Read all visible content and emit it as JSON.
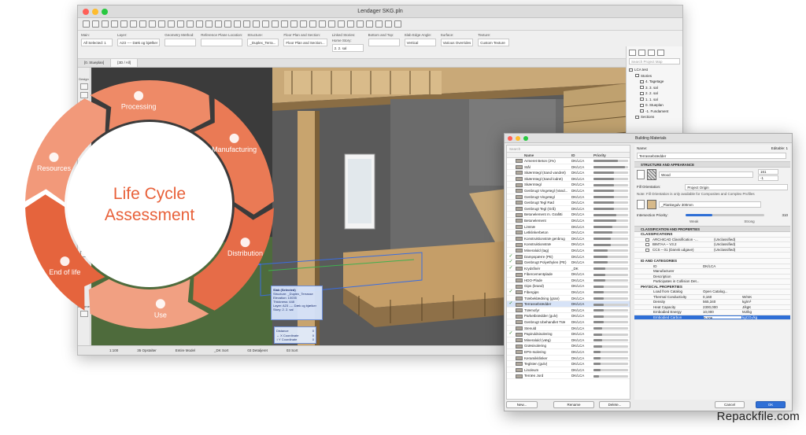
{
  "window": {
    "title": "Lendager SKG.pln"
  },
  "infobox": [
    {
      "label": "Main:",
      "value": "All Selected: 1"
    },
    {
      "label": "Layer:",
      "value": "A23 ---- Dæk og bjælker"
    },
    {
      "label": "Geometry Method:",
      "value": ""
    },
    {
      "label": "Reference Plane Location:",
      "value": ""
    },
    {
      "label": "Structure:",
      "value": "_Duplex_Terra..."
    },
    {
      "label": "Floor Plan and Section:",
      "value": "Floor Plan and Section..."
    },
    {
      "label": "Linked Stories:",
      "value": "2. 2. sal"
    },
    {
      "label": "Bottom and Top:",
      "value": ""
    },
    {
      "label": "Slab Edge Angle:",
      "value": "Vertical"
    },
    {
      "label": "Surface:",
      "value": "Various Overrides"
    },
    {
      "label": "Texture:",
      "value": "Custom Texture"
    }
  ],
  "infobox_extra": {
    "home_story_label": "Home Story:"
  },
  "tabs": [
    "[0. Stueplan]",
    "[3D / All]"
  ],
  "leftpanel": {
    "design_label": "Design",
    "viewpoint_label": "Viewpoi",
    "document_label": "Docume"
  },
  "statusbar": [
    "1:100",
    "35 Opstalter",
    "Entire Model",
    "_DK Sort",
    "03 Detaljeret",
    "03 Sort"
  ],
  "navigator": {
    "root": "LCA test",
    "items": [
      {
        "level": 1,
        "label": "Stories"
      },
      {
        "level": 2,
        "label": "4. Tagetage"
      },
      {
        "level": 2,
        "label": "3. 3. sal"
      },
      {
        "level": 2,
        "label": "2. 2. sal"
      },
      {
        "level": 2,
        "label": "1. 1. sal"
      },
      {
        "level": 2,
        "label": "0. Stueplan"
      },
      {
        "level": 2,
        "label": "-1. Fundament"
      },
      {
        "level": 1,
        "label": "Sections"
      }
    ]
  },
  "selection_popup": {
    "lines": [
      "Slab (Selected)",
      "Structure: _Duplex_Terrasse",
      "Elevation: 10035",
      "Thickness: 448",
      "Layer: A23 ---- Dæk og bjælker",
      "Story: 2. 2. sal"
    ]
  },
  "coord_popup": {
    "lines": [
      "Distance",
      "↔ X Coordinate",
      "↕ Y Coordinate"
    ],
    "values": [
      "0",
      "0",
      "0"
    ]
  },
  "lca_graphic": {
    "title_line1": "Life Cycle",
    "title_line2": "Assessment",
    "stages": [
      "Resources",
      "Processing",
      "Manufacturing",
      "Distribution",
      "Use",
      "End of life"
    ]
  },
  "building_materials": {
    "title": "Building Materials",
    "search_placeholder": "Search",
    "columns": {
      "name": "Name",
      "id": "ID",
      "priority": "Priority"
    },
    "materials": [
      {
        "name": "Armeret Beton (2%)",
        "id": "DK/LCA",
        "priority": 0.7,
        "checked": false
      },
      {
        "name": "Stål",
        "id": "DK/LCA",
        "priority": 0.9,
        "checked": false
      },
      {
        "name": "Skærmtegl (Sand vandret)",
        "id": "DK/LCA",
        "priority": 0.6,
        "checked": false
      },
      {
        "name": "Skærmtegl (Sand lodret)",
        "id": "DK/LCA",
        "priority": 0.6,
        "checked": false
      },
      {
        "name": "Skærmtegl",
        "id": "DK/LCA",
        "priority": 0.6,
        "checked": false
      },
      {
        "name": "Genbrugt Vingetegl (Vand...",
        "id": "DK/LCA",
        "priority": 0.6,
        "checked": false
      },
      {
        "name": "Genbrugt Vingetegl",
        "id": "DK/LCA",
        "priority": 0.6,
        "checked": false
      },
      {
        "name": "Genbrugt Tegl Rød",
        "id": "DK/LCA",
        "priority": 0.6,
        "checked": false
      },
      {
        "name": "Genbrugt Tegl (Grå)",
        "id": "DK/LCA",
        "priority": 0.6,
        "checked": false
      },
      {
        "name": "Betonelement m. Grafitti",
        "id": "DK/LCA",
        "priority": 0.65,
        "checked": false
      },
      {
        "name": "Betonelement",
        "id": "DK/LCA",
        "priority": 0.65,
        "checked": false
      },
      {
        "name": "Limtræ",
        "id": "DK/LCA",
        "priority": 0.55,
        "checked": false
      },
      {
        "name": "Letklinkerbeton",
        "id": "DK/LCA",
        "priority": 0.55,
        "checked": false
      },
      {
        "name": "Konstruktionstræ genbrug",
        "id": "DK/LCA",
        "priority": 0.5,
        "checked": false
      },
      {
        "name": "Konstruktionstræ",
        "id": "DK/LCA",
        "priority": 0.5,
        "checked": false
      },
      {
        "name": "Mineraluld (tag)",
        "id": "DK/LCA",
        "priority": 0.4,
        "checked": false
      },
      {
        "name": "Dampspærre (PE)",
        "id": "DK/LCA",
        "priority": 0.4,
        "checked": true
      },
      {
        "name": "Genbrugt Polyethylen (PE)",
        "id": "DK/LCA",
        "priority": 0.4,
        "checked": true
      },
      {
        "name": "Krydsfinér",
        "id": "_DK",
        "priority": 0.35,
        "checked": true
      },
      {
        "name": "Fibercementplade",
        "id": "DK/LCA",
        "priority": 0.35,
        "checked": false
      },
      {
        "name": "HDO-Plade",
        "id": "DK/LCA",
        "priority": 0.35,
        "checked": false
      },
      {
        "name": "Gips (brand)",
        "id": "DK/LCA",
        "priority": 0.3,
        "checked": false
      },
      {
        "name": "Fibergips",
        "id": "DK/LCA",
        "priority": 0.3,
        "checked": true
      },
      {
        "name": "Træbeklædning (gran)",
        "id": "DK/LCA",
        "priority": 0.3,
        "checked": false
      },
      {
        "name": "Terrassebrædder",
        "id": "DK/LCA",
        "priority": 0.3,
        "checked": true,
        "selected": true
      },
      {
        "name": "Træmofyr",
        "id": "DK/LCA",
        "priority": 0.3,
        "checked": false
      },
      {
        "name": "Parketbrædder (gulv)",
        "id": "DK/LCA",
        "priority": 0.3,
        "checked": false
      },
      {
        "name": "Genbrugt Ubehandlet Træ",
        "id": "DK/LCA",
        "priority": 0.3,
        "checked": false
      },
      {
        "name": "Stenuld",
        "id": "DK/LCA",
        "priority": 0.25,
        "checked": false
      },
      {
        "name": "Papiruldsisolering",
        "id": "DK/LCA",
        "priority": 0.25,
        "checked": true
      },
      {
        "name": "Mineraluld (væg)",
        "id": "DK/LCA",
        "priority": 0.25,
        "checked": false
      },
      {
        "name": "Græsisolering",
        "id": "DK/LCA",
        "priority": 0.25,
        "checked": false
      },
      {
        "name": "EPS-Isolering",
        "id": "DK/LCA",
        "priority": 0.2,
        "checked": false
      },
      {
        "name": "Keramikklinker",
        "id": "DK/LCA",
        "priority": 0.2,
        "checked": false
      },
      {
        "name": "Teglsten (gulv)",
        "id": "DK/LCA",
        "priority": 0.2,
        "checked": false
      },
      {
        "name": "Linoleum",
        "id": "DK/LCA",
        "priority": 0.2,
        "checked": false
      },
      {
        "name": "Terræn Jord",
        "id": "DK/LCA",
        "priority": 0.15,
        "checked": false
      }
    ],
    "buttons": {
      "new": "New...",
      "rename": "Rename",
      "delete": "Delete..."
    },
    "right": {
      "name_label": "Name:",
      "editable_label": "Editable: 1",
      "name_value": "Terrassebrædder",
      "structure_section": "STRUCTURE AND APPEARANCE",
      "fill_label": "Wood",
      "fill_num_1": "161",
      "fill_num_2": "-1",
      "fill_orientation_label": "Fill Orientation:",
      "fill_orientation_value": "Project Origin",
      "fill_note": "Note: Fill Orientation is only available for Composites and Complex Profiles",
      "surface_value": "_Plankegulv 300mm",
      "intersection_label": "Intersection Priority:",
      "intersection_value": "310",
      "intersection_fraction": 0.34,
      "weak_label": "Weak",
      "strong_label": "Strong",
      "classification_section": "CLASSIFICATION AND PROPERTIES",
      "classifications_header": "CLASSIFICATIONS",
      "classifications": [
        {
          "name": "ARCHICAD Classification -...",
          "value": "(Unclassified)"
        },
        {
          "name": "BIM7AA – V3.2",
          "value": "(Unclassified)"
        },
        {
          "name": "CCS – 01 (Dansk udgave)",
          "value": "(Unclassified)"
        }
      ],
      "id_section": "ID AND CATEGORIES",
      "id_props": [
        {
          "name": "ID",
          "value": "DK/LCA",
          "unit": ""
        },
        {
          "name": "Manufacturer",
          "value": "",
          "unit": ""
        },
        {
          "name": "Description",
          "value": "",
          "unit": ""
        },
        {
          "name": "Participates in Collision Det...",
          "value": "",
          "unit": ""
        }
      ],
      "physical_section": "PHYSICAL PROPERTIES",
      "physical_props": [
        {
          "name": "Load from Catalog",
          "value": "Open Catalog...",
          "unit": ""
        },
        {
          "name": "Thermal Conductivity",
          "value": "0,160",
          "unit": "W/mK"
        },
        {
          "name": "Density",
          "value": "565,340",
          "unit": "kg/m³"
        },
        {
          "name": "Heat Capacity",
          "value": "2300,000",
          "unit": "J/kgK"
        },
        {
          "name": "Embodied Energy",
          "value": "10,000",
          "unit": "MJ/kg"
        },
        {
          "name": "Embodied Carbon",
          "value": "0,106",
          "unit": "kgCO₂/kg",
          "highlight": true
        }
      ],
      "cancel": "Cancel",
      "ok": "OK"
    }
  },
  "watermark": "Repackfile.com",
  "colors": {
    "lca_orange": "#e8613a",
    "lca_orange_light": "#f3a58a",
    "ok_blue": "#2f6fd6"
  }
}
